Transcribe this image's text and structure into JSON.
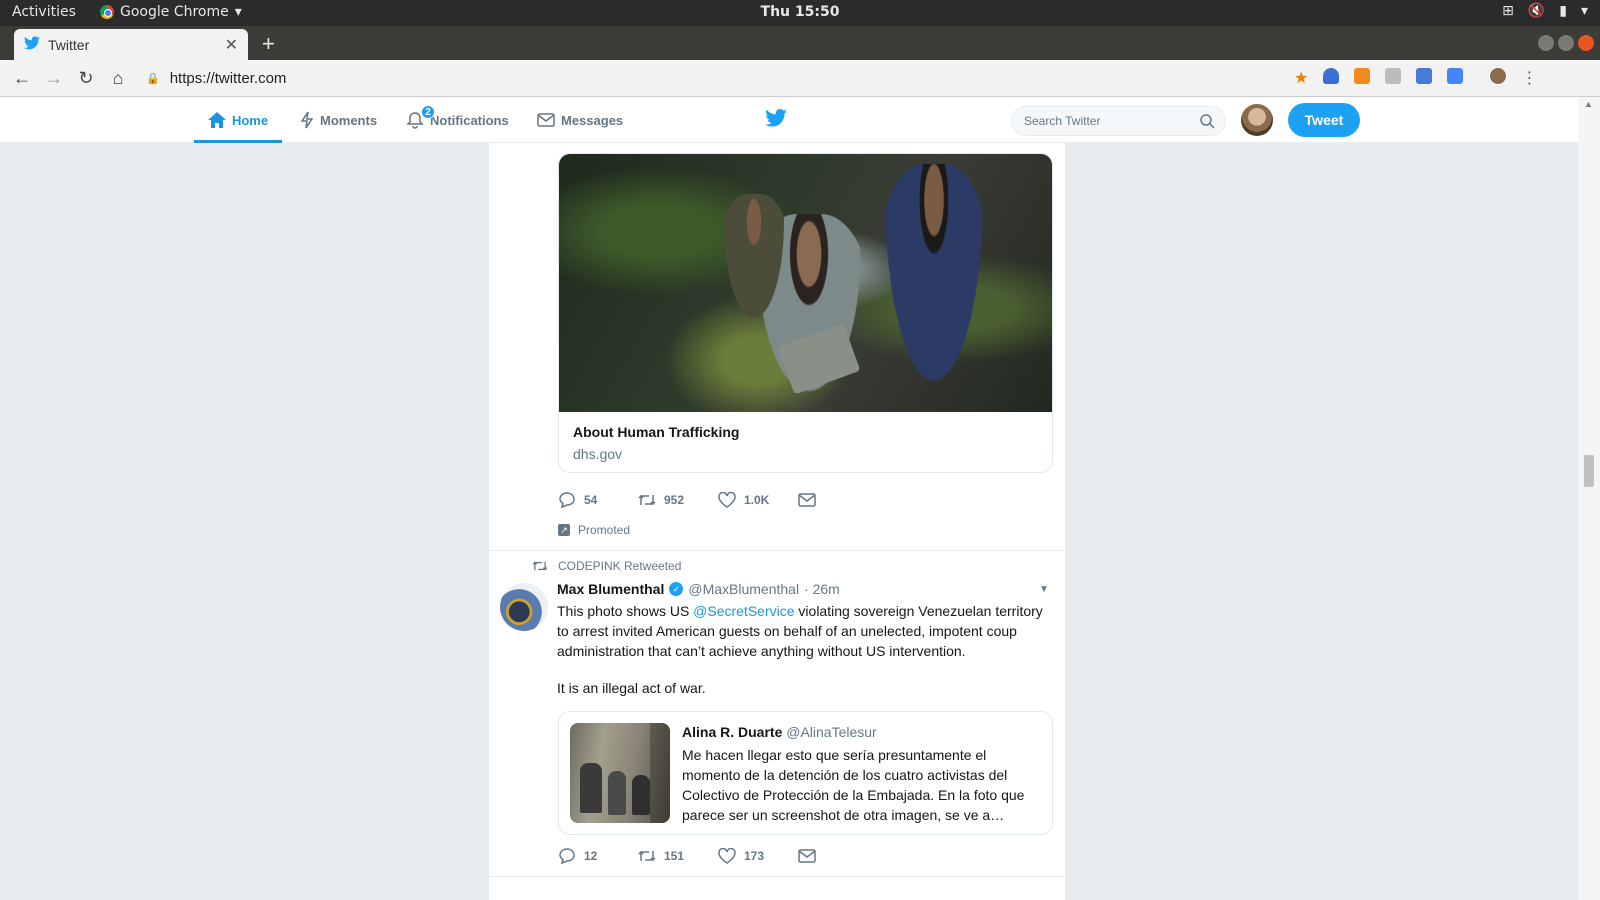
{
  "system": {
    "activities": "Activities",
    "app_name": "Google Chrome",
    "clock": "Thu 15:50"
  },
  "browser": {
    "tab_title": "Twitter",
    "url": "https://twitter.com"
  },
  "twitter_nav": {
    "home": "Home",
    "moments": "Moments",
    "notifications": "Notifications",
    "notifications_badge": "2",
    "messages": "Messages",
    "search_placeholder": "Search Twitter",
    "tweet_button": "Tweet",
    "accent_color": "#1da1f2"
  },
  "promoted_tweet": {
    "card_title": "About Human Trafficking",
    "card_domain": "dhs.gov",
    "replies": "54",
    "retweets": "952",
    "likes": "1.0K",
    "promoted_label": "Promoted"
  },
  "retweet": {
    "context": "CODEPINK Retweeted",
    "author_name": "Max Blumenthal",
    "author_handle": "@MaxBlumenthal",
    "time": "· 26m",
    "text_before": "This photo shows US ",
    "mention": "@SecretService",
    "text_after": " violating sovereign Venezuelan territory to arrest invited American guests on behalf of an unelected, impotent coup administration that can’t achieve anything without US intervention.",
    "text_line2": "It is an illegal act of war.",
    "quote": {
      "name": "Alina R. Duarte",
      "handle": "@AlinaTelesur",
      "text": "Me hacen llegar esto que sería presuntamente el momento de la detención de los cuatro activistas del Colectivo de Protección de la Embajada. En la foto que parece ser un screenshot de otra imagen, se ve a…"
    },
    "replies": "12",
    "retweets": "151",
    "likes": "173"
  }
}
